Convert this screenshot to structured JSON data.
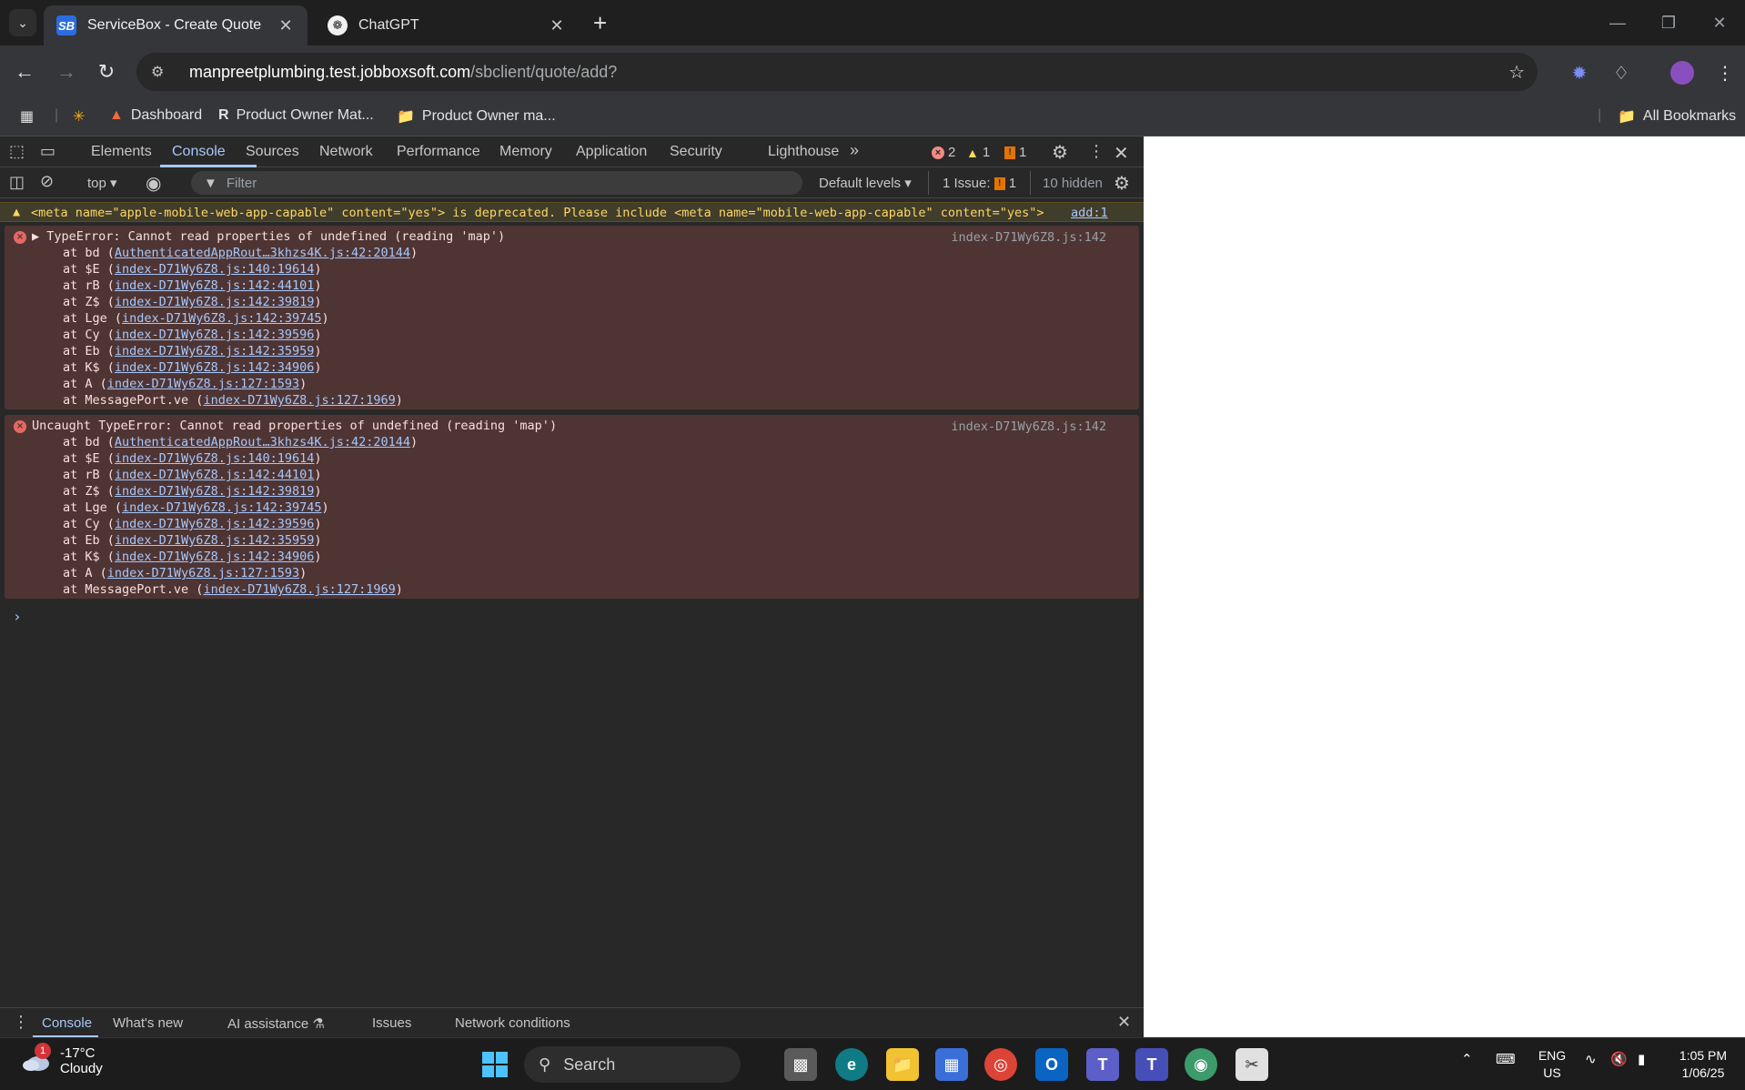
{
  "browser": {
    "tabs": [
      {
        "title": "ServiceBox - Create Quote",
        "favicon": "SB",
        "active": true
      },
      {
        "title": "ChatGPT",
        "favicon": "chatgpt-logo",
        "active": false
      }
    ],
    "url_host": "manpreetplumbing.test.jobboxsoft.com",
    "url_path": "/sbclient/quote/add?",
    "bookmarks": [
      {
        "label": "Dashboard"
      },
      {
        "label": "Product Owner Mat..."
      },
      {
        "label": "Product Owner ma..."
      }
    ],
    "all_bookmarks": "All Bookmarks"
  },
  "devtools": {
    "tabs": [
      "Elements",
      "Console",
      "Sources",
      "Network",
      "Performance",
      "Memory",
      "Application",
      "Security",
      "Lighthouse"
    ],
    "active_tab": "Console",
    "error_count": "2",
    "warning_count": "1",
    "issue_count": "1",
    "context": "top",
    "filter_placeholder": "Filter",
    "levels": "Default levels",
    "issues_label": "1 Issue:",
    "issues_num": "1",
    "hidden": "10 hidden",
    "warning": {
      "text": "<meta name=\"apple-mobile-web-app-capable\" content=\"yes\"> is deprecated. Please include <meta name=\"mobile-web-app-capable\" content=\"yes\">",
      "link": "add:1"
    },
    "errors": [
      {
        "head": "▶ TypeError: Cannot read properties of undefined (reading 'map')",
        "source": "index-D71Wy6Z8.js:142",
        "frames": [
          {
            "fn": "at bd (",
            "loc": "AuthenticatedAppRout…3khzs4K.js:42:20144",
            "end": ")"
          },
          {
            "fn": "at $E (",
            "loc": "index-D71Wy6Z8.js:140:19614",
            "end": ")"
          },
          {
            "fn": "at rB (",
            "loc": "index-D71Wy6Z8.js:142:44101",
            "end": ")"
          },
          {
            "fn": "at Z$ (",
            "loc": "index-D71Wy6Z8.js:142:39819",
            "end": ")"
          },
          {
            "fn": "at Lge (",
            "loc": "index-D71Wy6Z8.js:142:39745",
            "end": ")"
          },
          {
            "fn": "at Cy (",
            "loc": "index-D71Wy6Z8.js:142:39596",
            "end": ")"
          },
          {
            "fn": "at Eb (",
            "loc": "index-D71Wy6Z8.js:142:35959",
            "end": ")"
          },
          {
            "fn": "at K$ (",
            "loc": "index-D71Wy6Z8.js:142:34906",
            "end": ")"
          },
          {
            "fn": "at A (",
            "loc": "index-D71Wy6Z8.js:127:1593",
            "end": ")"
          },
          {
            "fn": "at MessagePort.ve (",
            "loc": "index-D71Wy6Z8.js:127:1969",
            "end": ")"
          }
        ]
      },
      {
        "head": "Uncaught TypeError: Cannot read properties of undefined (reading 'map')",
        "source": "index-D71Wy6Z8.js:142",
        "frames": [
          {
            "fn": "at bd (",
            "loc": "AuthenticatedAppRout…3khzs4K.js:42:20144",
            "end": ")"
          },
          {
            "fn": "at $E (",
            "loc": "index-D71Wy6Z8.js:140:19614",
            "end": ")"
          },
          {
            "fn": "at rB (",
            "loc": "index-D71Wy6Z8.js:142:44101",
            "end": ")"
          },
          {
            "fn": "at Z$ (",
            "loc": "index-D71Wy6Z8.js:142:39819",
            "end": ")"
          },
          {
            "fn": "at Lge (",
            "loc": "index-D71Wy6Z8.js:142:39745",
            "end": ")"
          },
          {
            "fn": "at Cy (",
            "loc": "index-D71Wy6Z8.js:142:39596",
            "end": ")"
          },
          {
            "fn": "at Eb (",
            "loc": "index-D71Wy6Z8.js:142:35959",
            "end": ")"
          },
          {
            "fn": "at K$ (",
            "loc": "index-D71Wy6Z8.js:142:34906",
            "end": ")"
          },
          {
            "fn": "at A (",
            "loc": "index-D71Wy6Z8.js:127:1593",
            "end": ")"
          },
          {
            "fn": "at MessagePort.ve (",
            "loc": "index-D71Wy6Z8.js:127:1969",
            "end": ")"
          }
        ]
      }
    ],
    "drawer_tabs": [
      "Console",
      "What's new",
      "AI assistance",
      "Issues",
      "Network conditions"
    ]
  },
  "taskbar": {
    "weather_temp": "-17°C",
    "weather_desc": "Cloudy",
    "weather_badge": "1",
    "search_placeholder": "Search",
    "lang": "ENG",
    "region": "US",
    "time": "1:05 PM",
    "date": "1/06/25"
  },
  "colors": {
    "error_bg": "#4e3534",
    "warning_bg": "#413d2b",
    "accent": "#a8c7fa"
  }
}
